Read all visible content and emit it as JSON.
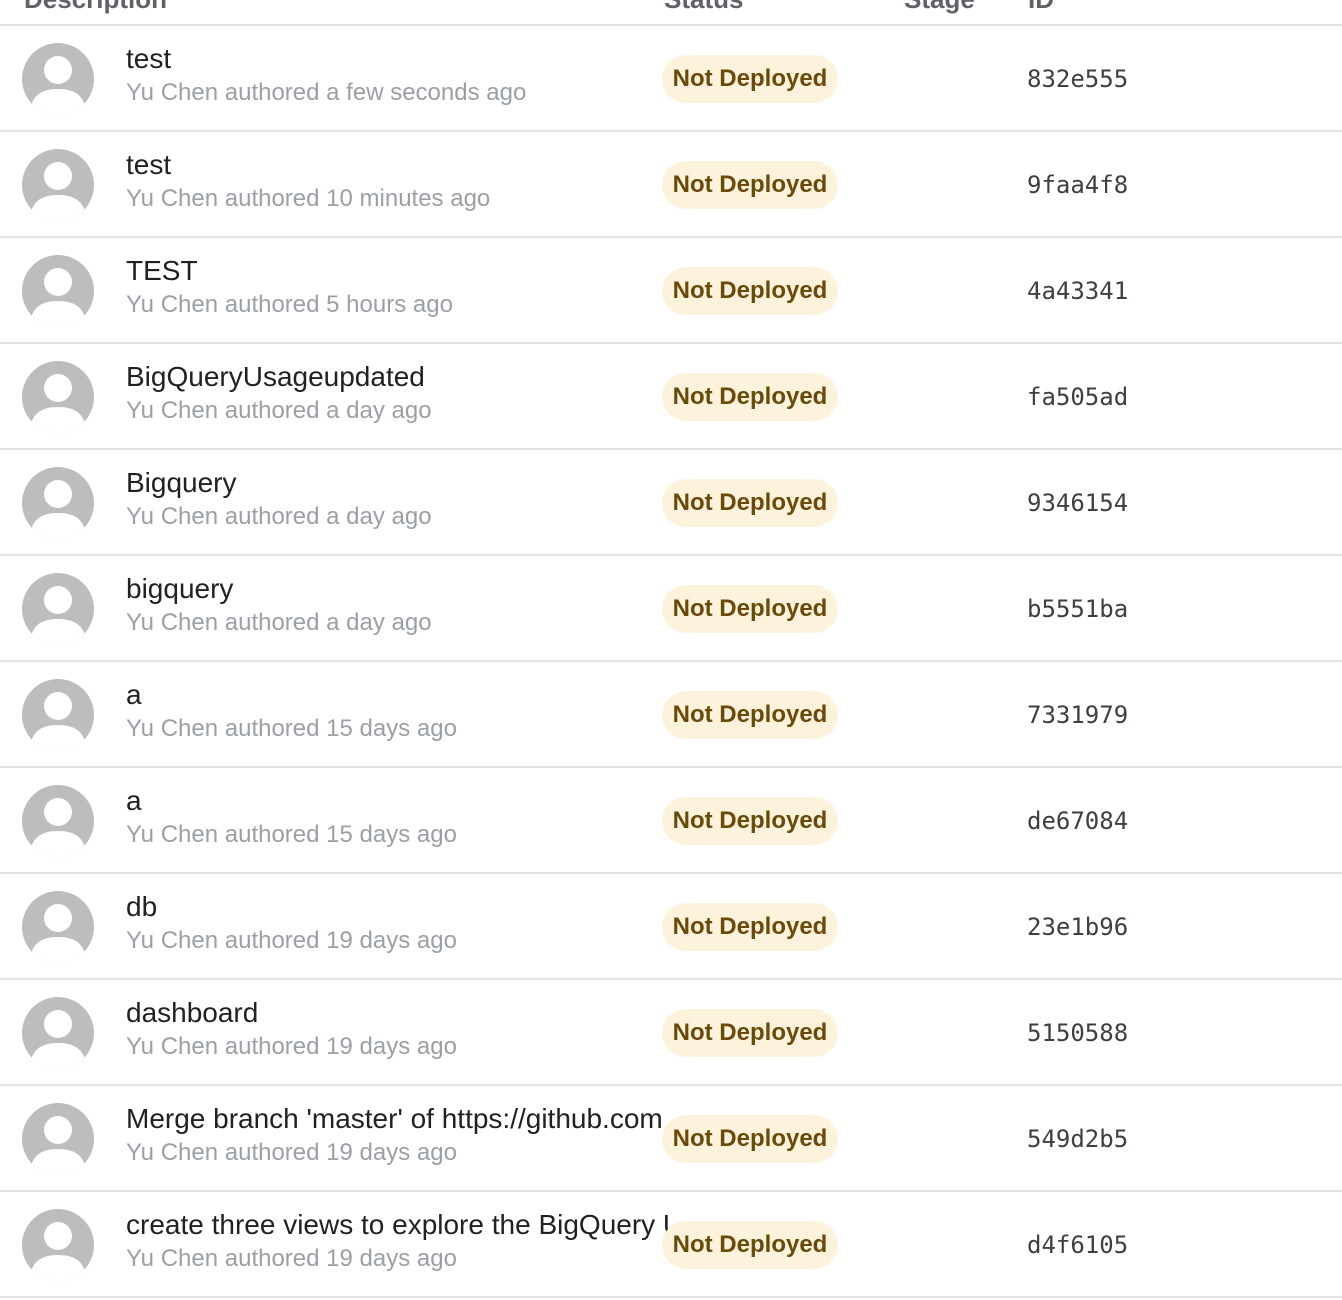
{
  "table": {
    "headers": {
      "description": "Description",
      "status": "Status",
      "stage": "Stage",
      "commit": "ID"
    },
    "rows": [
      {
        "title": "test",
        "author": "Yu Chen authored a few seconds ago",
        "status": "Not Deployed",
        "sha": "832e555"
      },
      {
        "title": "test",
        "author": "Yu Chen authored 10 minutes ago",
        "status": "Not Deployed",
        "sha": "9faa4f8"
      },
      {
        "title": "TEST",
        "author": "Yu Chen authored 5 hours ago",
        "status": "Not Deployed",
        "sha": "4a43341"
      },
      {
        "title": "BigQueryUsageupdated",
        "author": "Yu Chen authored a day ago",
        "status": "Not Deployed",
        "sha": "fa505ad"
      },
      {
        "title": "Bigquery",
        "author": "Yu Chen authored a day ago",
        "status": "Not Deployed",
        "sha": "9346154"
      },
      {
        "title": "bigquery",
        "author": "Yu Chen authored a day ago",
        "status": "Not Deployed",
        "sha": "b5551ba"
      },
      {
        "title": "a",
        "author": "Yu Chen authored 15 days ago",
        "status": "Not Deployed",
        "sha": "7331979"
      },
      {
        "title": "a",
        "author": "Yu Chen authored 15 days ago",
        "status": "Not Deployed",
        "sha": "de67084"
      },
      {
        "title": "db",
        "author": "Yu Chen authored 19 days ago",
        "status": "Not Deployed",
        "sha": "23e1b96"
      },
      {
        "title": "dashboard",
        "author": "Yu Chen authored 19 days ago",
        "status": "Not Deployed",
        "sha": "5150588"
      },
      {
        "title": "Merge branch 'master' of https://github.com",
        "author": "Yu Chen authored 19 days ago",
        "status": "Not Deployed",
        "sha": "549d2b5"
      },
      {
        "title": "create three views to explore the BigQuery U",
        "author": "Yu Chen authored 19 days ago",
        "status": "Not Deployed",
        "sha": "d4f6105"
      }
    ]
  },
  "icons": {
    "avatar": "default-user-avatar-icon"
  },
  "colors": {
    "badge_bg": "#fdf2dc",
    "badge_text": "#6b4a09",
    "avatar_gray": "#bdbdbd",
    "divider": "#e3e3e3"
  }
}
